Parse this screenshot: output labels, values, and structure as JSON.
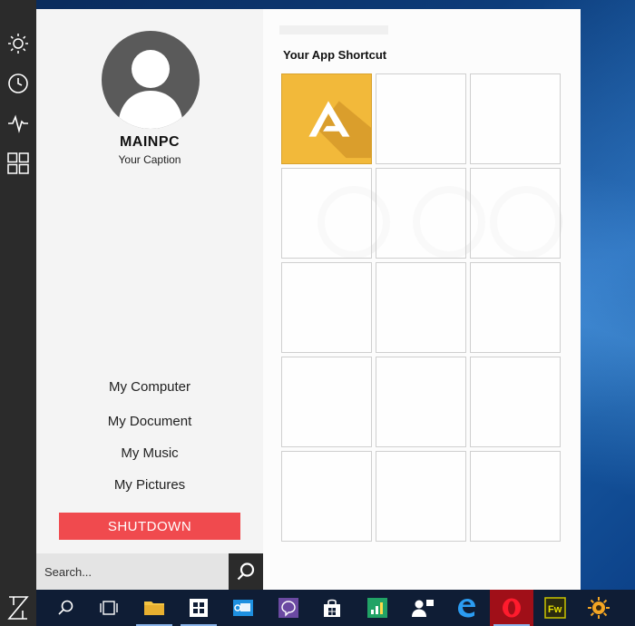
{
  "user": {
    "name": "MAINPC",
    "caption": "Your Caption"
  },
  "menu": {
    "links": [
      "My Computer",
      "My Document",
      "My Music",
      "My Pictures"
    ],
    "shutdown_label": "SHUTDOWN"
  },
  "search": {
    "placeholder": "Search..."
  },
  "shortcuts": {
    "title": "Your App Shortcut",
    "tile_count": 15
  },
  "colors": {
    "accent_red": "#f04a4e",
    "app_tile_orange": "#f2b93a",
    "sidebar_dark": "#2b2b2b",
    "taskbar": "#0f1d35"
  },
  "icons": {
    "sidebar": [
      "sun-icon",
      "clock-icon",
      "pulse-icon",
      "grid-icon"
    ],
    "taskbar": [
      "start-z-icon",
      "search-icon",
      "task-view-icon",
      "file-explorer-icon",
      "store-icon",
      "outlook-icon",
      "messenger-icon",
      "store-bag-icon",
      "excel-icon",
      "people-icon",
      "edge-icon",
      "opera-icon",
      "fireworks-icon",
      "xnview-icon"
    ]
  }
}
